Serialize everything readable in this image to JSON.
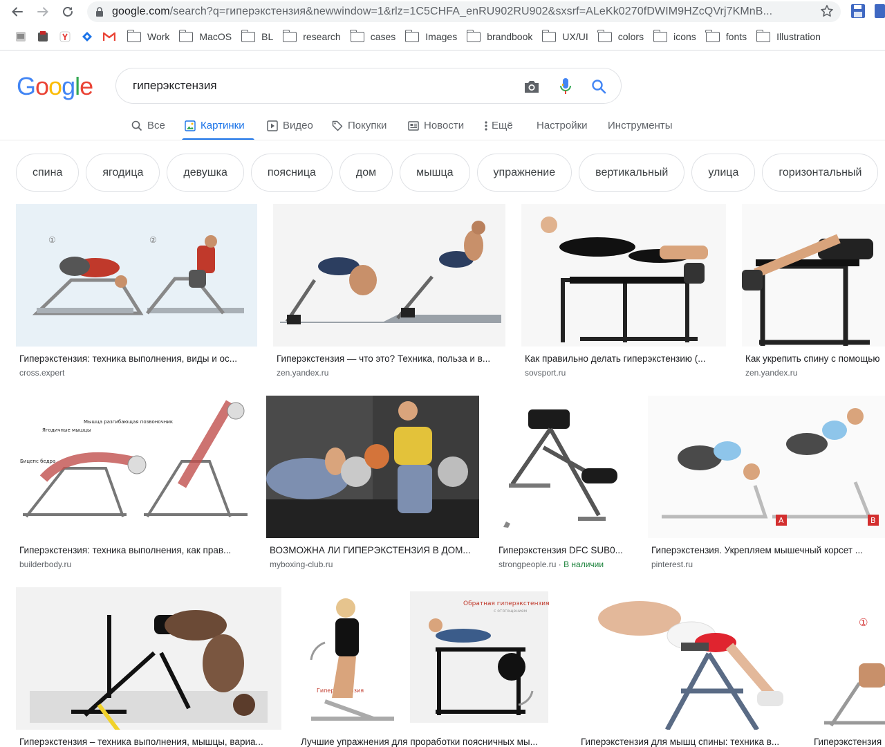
{
  "browser": {
    "url_host": "google.com",
    "url_path": "/search?q=гиперэкстензия&newwindow=1&rlz=1C5CHFA_enRU902RU902&sxsrf=ALeKk0270fDWIM9HZcQVrj7KMnB...",
    "bookmarks": {
      "icons": [
        "bookmark-page-icon",
        "bookmark-app-icon",
        "yandex-icon",
        "diamond-icon",
        "gmail-icon"
      ],
      "folders": [
        "Work",
        "MacOS",
        "BL",
        "research",
        "cases",
        "Images",
        "brandbook",
        "UX/UI",
        "colors",
        "icons",
        "fonts",
        "Illustration"
      ]
    }
  },
  "google": {
    "logo": "Google",
    "query": "гиперэкстензия",
    "tabs": {
      "all": "Все",
      "images": "Картинки",
      "video": "Видео",
      "shopping": "Покупки",
      "news": "Новости",
      "more": "Ещё",
      "settings": "Настройки",
      "tools": "Инструменты"
    },
    "chips": [
      "спина",
      "ягодица",
      "девушка",
      "поясница",
      "дом",
      "мышца",
      "упражнение",
      "вертикальный",
      "улица",
      "горизонтальный"
    ]
  },
  "results": [
    {
      "title": "Гиперэкстензия: техника выполнения, виды и ос...",
      "source": "cross.expert"
    },
    {
      "title": "Гиперэкстензия — что это? Техника, польза и в...",
      "source": "zen.yandex.ru"
    },
    {
      "title": "Как правильно делать гиперэкстензию (...",
      "source": "sovsport.ru"
    },
    {
      "title": "Как укрепить спину с помощью",
      "source": "zen.yandex.ru"
    },
    {
      "title": "Гиперэкстензия: техника выполнения, как прав...",
      "source": "builderbody.ru"
    },
    {
      "title": "ВОЗМОЖНА ЛИ ГИПЕРЭКСТЕНЗИЯ В ДОМ...",
      "source": "myboxing-club.ru"
    },
    {
      "title": "Гиперэкстензия DFC SUB0...",
      "source": "strongpeople.ru",
      "badge": "В наличии"
    },
    {
      "title": "Гиперэкстензия. Укрепляем мышечный корсет ...",
      "source": "pinterest.ru"
    },
    {
      "title": "Гиперэкстензия – техника выполнения, мышцы, вариа...",
      "source": ""
    },
    {
      "title": "Лучшие упражнения для проработки поясничных мы...",
      "source": ""
    },
    {
      "title": "Гиперэкстензия для мышц спины: техника в...",
      "source": ""
    },
    {
      "title": "Гиперэкстензия",
      "source": ""
    }
  ],
  "image_labels": {
    "step_one": "①",
    "step_two": "②",
    "muscle_glutes": "Ягодичные мышцы",
    "muscle_erector": "Мышца разгибающая позвоночник",
    "muscle_biceps": "Бицепс бедра",
    "reverse_hyper": "Обратная гиперэкстензия",
    "reverse_hyper_sub": "с отягощением",
    "hyper_label": "Гиперэкстензия",
    "marker_a": "A",
    "marker_b": "B",
    "step_one_b": "①"
  },
  "colors": {
    "accent": "#1a73e8",
    "instock": "#188038",
    "logo_blue": "#4285f4",
    "logo_red": "#ea4335",
    "logo_yellow": "#fbbc05",
    "logo_green": "#34a853"
  }
}
